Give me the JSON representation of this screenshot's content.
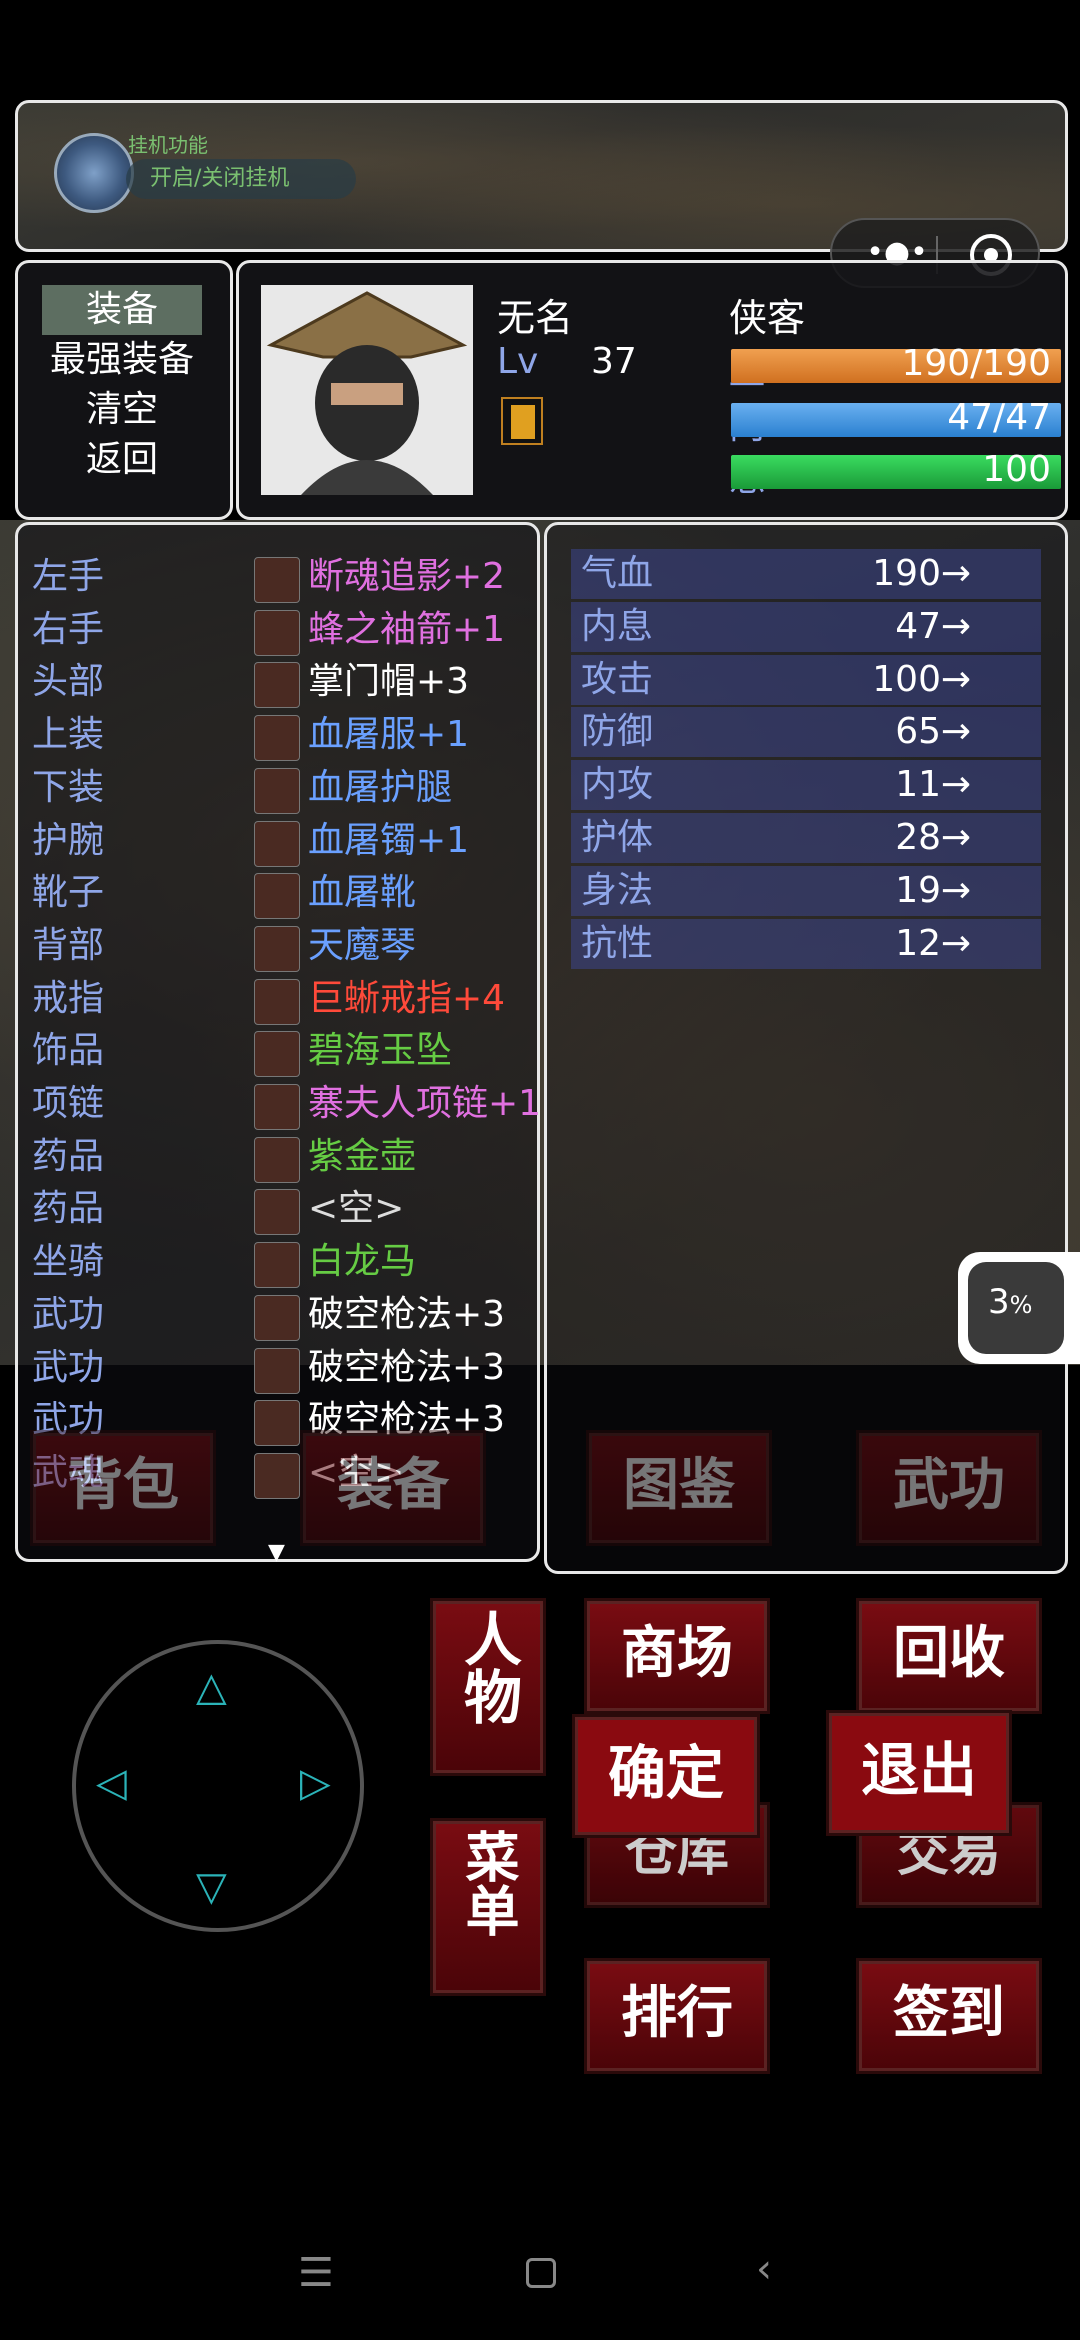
{
  "top_bar": {
    "auto_label": "挂机功能",
    "auto_toggle": "开启/关闭挂机"
  },
  "side_menu": {
    "items": [
      "装备",
      "最强装备",
      "清空",
      "返回"
    ],
    "selected": 0
  },
  "character": {
    "name": "无名",
    "class": "侠客",
    "lv_label": "Lv",
    "level": "37",
    "hp_label": "血",
    "hp_text": "190/190",
    "hp_fraction": 1.0,
    "mp_label": "内",
    "mp_text": "47/47",
    "mp_fraction": 1.0,
    "rage_label": "怒",
    "rage_text": "100",
    "rage_fraction": 1.0
  },
  "equipment": [
    {
      "slot": "左手",
      "item": "断魂追影+2",
      "color": "#e070e0"
    },
    {
      "slot": "右手",
      "item": "蜂之袖箭+1",
      "color": "#e070e0"
    },
    {
      "slot": "头部",
      "item": "掌门帽+3",
      "color": "#ffffff"
    },
    {
      "slot": "上装",
      "item": "血屠服+1",
      "color": "#6aa0ff"
    },
    {
      "slot": "下装",
      "item": "血屠护腿",
      "color": "#6aa0ff"
    },
    {
      "slot": "护腕",
      "item": "血屠镯+1",
      "color": "#6aa0ff"
    },
    {
      "slot": "靴子",
      "item": "血屠靴",
      "color": "#6aa0ff"
    },
    {
      "slot": "背部",
      "item": "天魔琴",
      "color": "#6aa0ff"
    },
    {
      "slot": "戒指",
      "item": "巨蜥戒指+4",
      "color": "#ff4a3a"
    },
    {
      "slot": "饰品",
      "item": "碧海玉坠",
      "color": "#66cc44"
    },
    {
      "slot": "项链",
      "item": "寨夫人项链+1",
      "color": "#e070e0"
    },
    {
      "slot": "药品",
      "item": "紫金壶",
      "color": "#66cc44"
    },
    {
      "slot": "药品",
      "item": "<空>",
      "color": "#dddddd"
    },
    {
      "slot": "坐骑",
      "item": "白龙马",
      "color": "#66cc44"
    },
    {
      "slot": "武功",
      "item": "破空枪法+3",
      "color": "#ffffff"
    },
    {
      "slot": "武功",
      "item": "破空枪法+3",
      "color": "#ffffff"
    },
    {
      "slot": "武功",
      "item": "破空枪法+3",
      "color": "#ffffff"
    },
    {
      "slot": "武魂",
      "item": "<空>",
      "color": "#dddddd"
    }
  ],
  "stats": [
    {
      "name": "气血",
      "value": "190",
      "arrow": "→"
    },
    {
      "name": "内息",
      "value": "47",
      "arrow": "→"
    },
    {
      "name": "攻击",
      "value": "100",
      "arrow": "→"
    },
    {
      "name": "防御",
      "value": "65",
      "arrow": "→"
    },
    {
      "name": "内攻",
      "value": "11",
      "arrow": "→"
    },
    {
      "name": "护体",
      "value": "28",
      "arrow": "→"
    },
    {
      "name": "身法",
      "value": "19",
      "arrow": "→"
    },
    {
      "name": "抗性",
      "value": "12",
      "arrow": "→"
    }
  ],
  "bg_buttons": [
    "背包",
    "装备",
    "图鉴",
    "武功"
  ],
  "action_buttons": {
    "renwu": "人物",
    "shangchang": "商场",
    "huishou": "回收",
    "queding": "确定",
    "tuichu": "退出",
    "caidan": "菜单",
    "paihang": "排行",
    "qiandao": "签到",
    "hidden_left": "仓库",
    "hidden_right": "交易"
  },
  "percent_badge": "3",
  "percent_unit": "%"
}
